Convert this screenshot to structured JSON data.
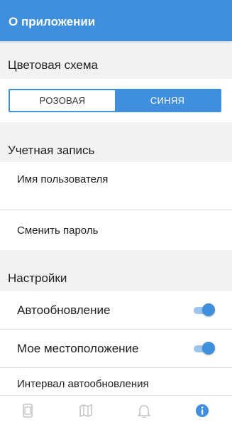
{
  "appbar": {
    "title": "О приложении"
  },
  "color_scheme": {
    "header": "Цветовая схема",
    "options": [
      "РОЗОВАЯ",
      "СИНЯЯ"
    ],
    "selected": "СИНЯЯ"
  },
  "account": {
    "header": "Учетная запись",
    "username_label": "Имя пользователя",
    "change_password_label": "Сменить пароль"
  },
  "settings": {
    "header": "Настройки",
    "auto_update_label": "Автообновление",
    "auto_update_on": true,
    "location_label": "Мое местоположение",
    "location_on": true,
    "interval_label": "Интервал автообновления"
  },
  "bottom_nav": {
    "items": [
      "device-icon",
      "map-icon",
      "bell-icon",
      "info-icon"
    ],
    "active": "info-icon"
  },
  "colors": {
    "accent": "#3f8fdc",
    "background": "#f2f2f2",
    "surface": "#ffffff"
  }
}
